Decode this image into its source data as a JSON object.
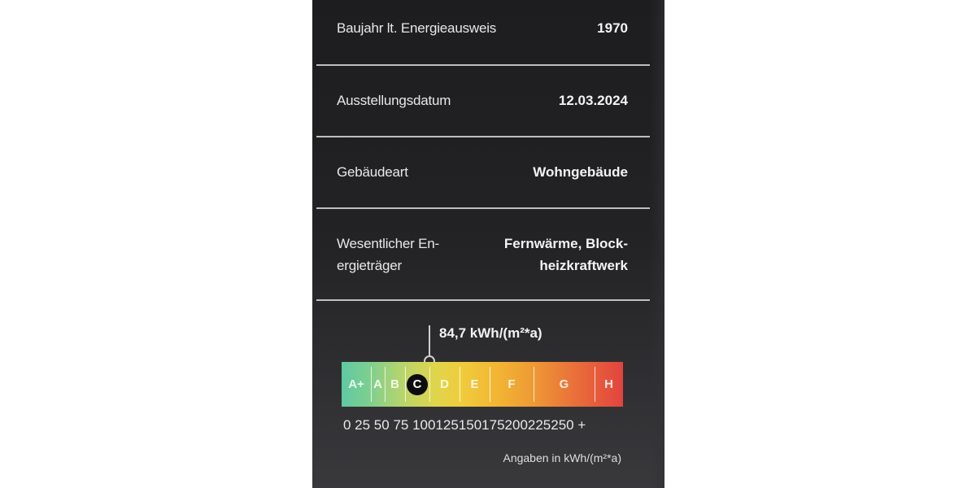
{
  "rows": [
    {
      "label": "Baujahr lt. Energieausweis",
      "value": "1970"
    },
    {
      "label": "Ausstellungsdatum",
      "value": "12.03.2024"
    },
    {
      "label": "Gebäudeart",
      "value": "Wohngebäude"
    },
    {
      "label_line1": "Wesentlicher En-",
      "label_line2": "ergieträger",
      "value_line1": "Fernwärme, Block-",
      "value_line2": "heizkraftwerk"
    }
  ],
  "efficiency": {
    "value_text": "84,7 kWh/(m²*a)",
    "value": 84.7,
    "current_class": "C",
    "classes": [
      "A+",
      "A",
      "B",
      "C",
      "D",
      "E",
      "F",
      "G",
      "H"
    ],
    "scale_ticks": "0  25  50  75  100125150175200225250  +",
    "unit_note": "Angaben in kWh/(m²*a)"
  }
}
